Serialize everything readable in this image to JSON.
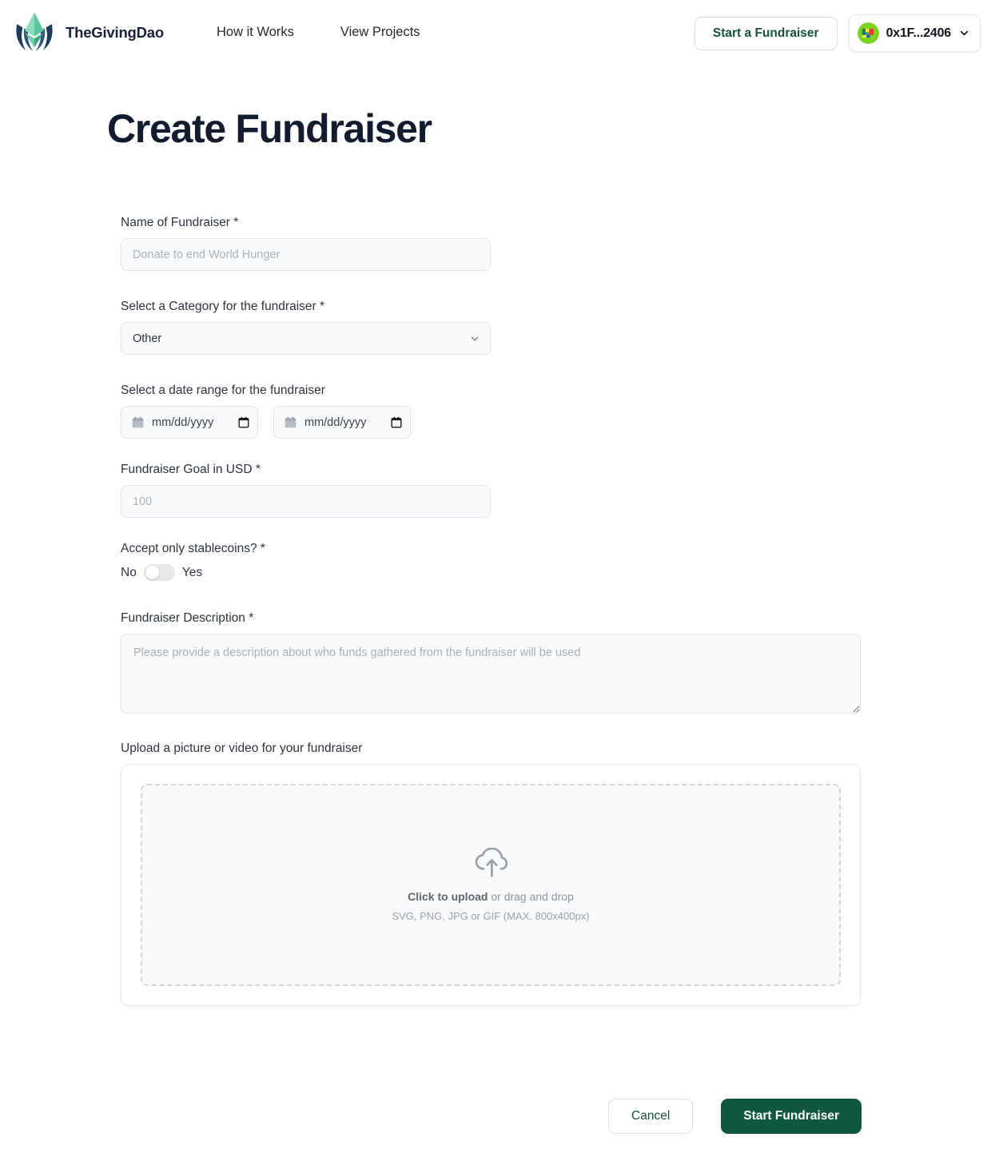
{
  "header": {
    "brand_name": "TheGivingDao",
    "logo_icon": "ethereum-hands-logo",
    "nav": [
      {
        "label": "How it Works"
      },
      {
        "label": "View Projects"
      }
    ],
    "start_fundraiser_label": "Start a Fundraiser",
    "wallet": {
      "address": "0x1F...2406",
      "avatar_icon": "wallet-blockie-avatar",
      "chevron_icon": "chevron-down-icon"
    }
  },
  "page": {
    "title": "Create Fundraiser"
  },
  "form": {
    "name": {
      "label": "Name of Fundraiser *",
      "placeholder": "Donate to end World Hunger",
      "value": ""
    },
    "category": {
      "label": "Select a Category for the fundraiser *",
      "selected": "Other",
      "options": [
        "Other"
      ],
      "chevron_icon": "chevron-down-icon"
    },
    "date_range": {
      "label": "Select a date range for the fundraiser",
      "start": {
        "placeholder": "mm/dd/yyyy",
        "value": "",
        "left_icon": "calendar-icon",
        "picker_icon": "calendar-picker-icon"
      },
      "end": {
        "placeholder": "mm/dd/yyyy",
        "value": "",
        "left_icon": "calendar-icon",
        "picker_icon": "calendar-picker-icon"
      }
    },
    "goal": {
      "label": "Fundraiser Goal in USD *",
      "placeholder": "100",
      "value": ""
    },
    "stablecoins": {
      "label": "Accept only stablecoins? *",
      "off_label": "No",
      "on_label": "Yes",
      "state": "off"
    },
    "description": {
      "label": "Fundraiser Description *",
      "placeholder": "Please provide a description about who funds gathered from the fundraiser will be used",
      "value": ""
    },
    "upload": {
      "label": "Upload a picture or video for your fundraiser",
      "icon": "cloud-upload-icon",
      "cta_bold": "Click to upload",
      "cta_rest": " or drag and drop",
      "hint": "SVG, PNG, JPG or GIF (MAX. 800x400px)"
    }
  },
  "actions": {
    "cancel_label": "Cancel",
    "submit_label": "Start Fundraiser"
  },
  "colors": {
    "brand_green_dark": "#0f5740",
    "brand_green_text": "#14503c",
    "logo_green": "#3fb68b",
    "logo_navy": "#1e3a5f",
    "input_bg": "#f9fafb",
    "border": "#dfe3e8",
    "title": "#121c2e"
  }
}
